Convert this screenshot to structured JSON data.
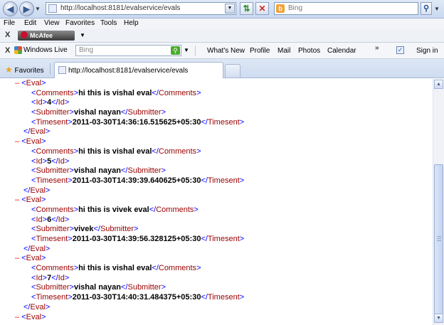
{
  "browser": {
    "address": "http://localhost:8181/evalservice/evals",
    "search_placeholder": "Bing",
    "menu": [
      "File",
      "Edit",
      "View",
      "Favorites",
      "Tools",
      "Help"
    ],
    "mcafee_label": "McAfee",
    "windows_live": {
      "label": "Windows Live",
      "search_placeholder": "Bing",
      "links": [
        "What's New",
        "Profile",
        "Mail",
        "Photos",
        "Calendar"
      ],
      "sign_in": "Sign in"
    },
    "favorites_label": "Favorites",
    "tab_title": "http://localhost:8181/evalservice/evals"
  },
  "xml": {
    "minus": "–",
    "eval_tag": "Eval",
    "comments_tag": "Comments",
    "id_tag": "Id",
    "submitter_tag": "Submitter",
    "timesent_tag": "Timesent",
    "evals": [
      {
        "comments": "hi this is vishal eval",
        "id": "4",
        "submitter": "vishal nayan",
        "timesent": "2011-03-30T14:36:16.515625+05:30"
      },
      {
        "comments": "hi this is vishal eval",
        "id": "5",
        "submitter": "vishal nayan",
        "timesent": "2011-03-30T14:39:39.640625+05:30"
      },
      {
        "comments": "hi this is vivek eval",
        "id": "6",
        "submitter": "vivek",
        "timesent": "2011-03-30T14:39:56.328125+05:30"
      },
      {
        "comments": "hi this is vishal eval",
        "id": "7",
        "submitter": "vishal nayan",
        "timesent": "2011-03-30T14:40:31.484375+05:30"
      }
    ]
  }
}
